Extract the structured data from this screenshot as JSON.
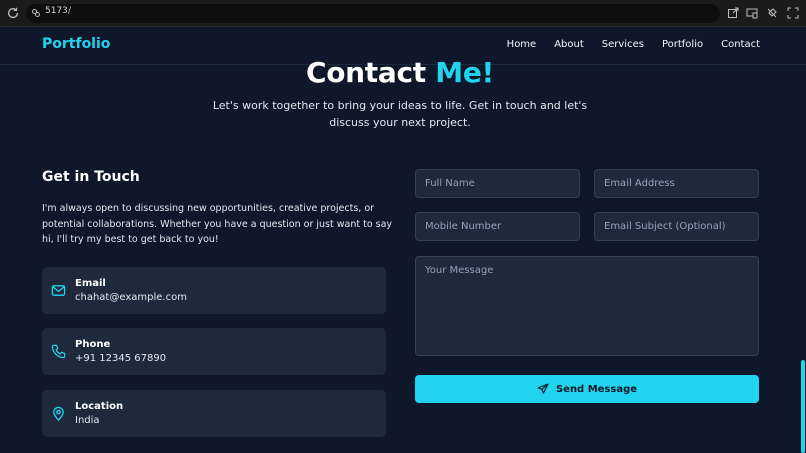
{
  "browser": {
    "url_port": "5173",
    "url_path": "/"
  },
  "nav": {
    "brand": "Portfolio",
    "links": [
      "Home",
      "About",
      "Services",
      "Portfolio",
      "Contact"
    ]
  },
  "hero": {
    "title_main": "Contact",
    "title_accent": "Me!",
    "subtitle": "Let's work together to bring your ideas to life. Get in touch and let's discuss your next project."
  },
  "info": {
    "title": "Get in Touch",
    "body": "I'm always open to discussing new opportunities, creative projects, or potential collaborations. Whether you have a question or just want to say hi, I'll try my best to get back to you!",
    "cards": [
      {
        "label": "Email",
        "value": "chahat@example.com",
        "icon": "mail-icon"
      },
      {
        "label": "Phone",
        "value": "+91 12345 67890",
        "icon": "phone-icon"
      },
      {
        "label": "Location",
        "value": "India",
        "icon": "location-pin-icon"
      }
    ]
  },
  "form": {
    "full_name_placeholder": "Full Name",
    "email_placeholder": "Email Address",
    "mobile_placeholder": "Mobile Number",
    "subject_placeholder": "Email Subject (Optional)",
    "message_placeholder": "Your Message",
    "send_label": "Send Message"
  },
  "colors": {
    "background": "#0f172a",
    "card": "#1e293b",
    "accent": "#22d3ee"
  }
}
